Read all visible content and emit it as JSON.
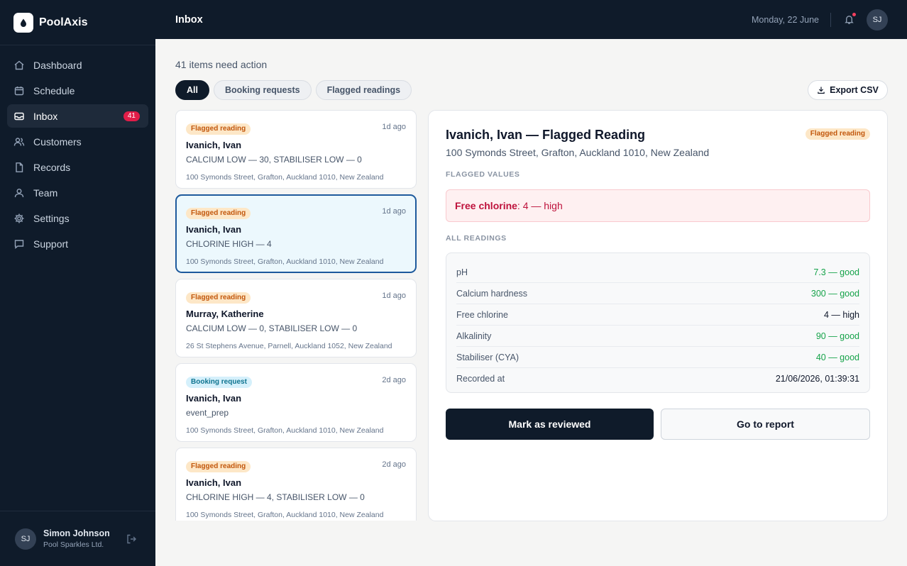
{
  "brand": {
    "name": "PoolAxis",
    "logo_icon": "droplet-icon"
  },
  "sidebar": {
    "items": [
      {
        "label": "Dashboard",
        "icon": "home-icon"
      },
      {
        "label": "Schedule",
        "icon": "calendar-icon"
      },
      {
        "label": "Inbox",
        "icon": "inbox-icon",
        "badge": "41"
      },
      {
        "label": "Customers",
        "icon": "users-icon"
      },
      {
        "label": "Records",
        "icon": "file-icon"
      },
      {
        "label": "Team",
        "icon": "user-icon"
      },
      {
        "label": "Settings",
        "icon": "gear-icon"
      },
      {
        "label": "Support",
        "icon": "chat-icon"
      }
    ],
    "active": "Inbox"
  },
  "user": {
    "initials": "SJ",
    "name": "Simon Johnson",
    "org": "Pool Sparkles Ltd."
  },
  "topbar": {
    "title": "Inbox",
    "date": "Monday, 22 June",
    "avatar_initials": "SJ"
  },
  "main": {
    "summary": "41 items need action",
    "filters": [
      "All",
      "Booking requests",
      "Flagged readings"
    ],
    "active_filter": "All",
    "export_label": "Export CSV"
  },
  "inbox": [
    {
      "tag": "Flagged reading",
      "tag_type": "flag",
      "time": "1d ago",
      "name": "Ivanich, Ivan",
      "summary": "CALCIUM LOW — 30, STABILISER LOW — 0",
      "address": "100 Symonds Street, Grafton, Auckland 1010, New Zealand"
    },
    {
      "tag": "Flagged reading",
      "tag_type": "flag",
      "time": "1d ago",
      "name": "Ivanich, Ivan",
      "summary": "CHLORINE HIGH — 4",
      "address": "100 Symonds Street, Grafton, Auckland 1010, New Zealand"
    },
    {
      "tag": "Flagged reading",
      "tag_type": "flag",
      "time": "1d ago",
      "name": "Murray, Katherine",
      "summary": "CALCIUM LOW — 0, STABILISER LOW — 0",
      "address": "26 St Stephens Avenue, Parnell, Auckland 1052, New Zealand"
    },
    {
      "tag": "Booking request",
      "tag_type": "book",
      "time": "2d ago",
      "name": "Ivanich, Ivan",
      "summary": "event_prep",
      "address": "100 Symonds Street, Grafton, Auckland 1010, New Zealand"
    },
    {
      "tag": "Flagged reading",
      "tag_type": "flag",
      "time": "2d ago",
      "name": "Ivanich, Ivan",
      "summary": "CHLORINE HIGH — 4, STABILISER LOW — 0",
      "address": "100 Symonds Street, Grafton, Auckland 1010, New Zealand"
    }
  ],
  "detail": {
    "title": "Ivanich, Ivan — Flagged Reading",
    "tag": "Flagged reading",
    "address": "100 Symonds Street, Grafton, Auckland 1010, New Zealand",
    "flagged_label": "FLAGGED VALUES",
    "flagged": {
      "name": "Free chlorine",
      "value": ": 4 — high"
    },
    "readings_label": "ALL READINGS",
    "readings": [
      {
        "label": "pH",
        "value": "7.3 — good",
        "status": "good"
      },
      {
        "label": "Calcium hardness",
        "value": "300 — good",
        "status": "good"
      },
      {
        "label": "Free chlorine",
        "value": "4 — high",
        "status": "high"
      },
      {
        "label": "Alkalinity",
        "value": "90 — good",
        "status": "good"
      },
      {
        "label": "Stabiliser (CYA)",
        "value": "40 — good",
        "status": "good"
      },
      {
        "label": "Recorded at",
        "value": "21/06/2026, 01:39:31",
        "status": "neutral"
      }
    ],
    "primary_action": "Mark as reviewed",
    "secondary_action": "Go to report"
  },
  "colors": {
    "sidebar_bg": "#0f1b2a",
    "accent_red": "#e11d48",
    "good": "#16a34a",
    "selected_border": "#1e5a9c"
  }
}
